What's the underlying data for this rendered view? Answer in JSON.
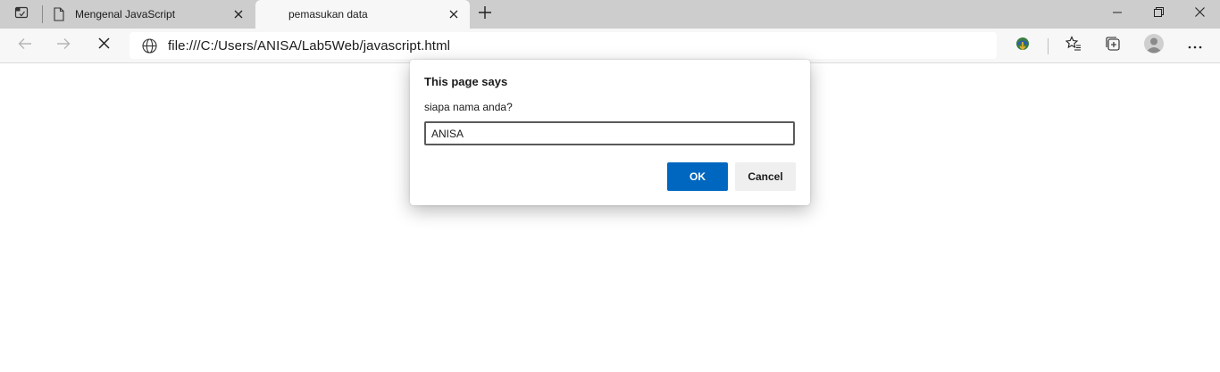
{
  "tabs": [
    {
      "title": "Mengenal JavaScript",
      "active": false,
      "icon": "document-icon"
    },
    {
      "title": "pemasukan data",
      "active": true,
      "icon": "none"
    }
  ],
  "address_bar": {
    "url": "file:///C:/Users/ANISA/Lab5Web/javascript.html",
    "site_icon": "globe-icon"
  },
  "dialog": {
    "title": "This page says",
    "message": "siapa nama anda?",
    "input_value": "ANISA",
    "ok_label": "OK",
    "cancel_label": "Cancel"
  },
  "colors": {
    "accent": "#0067c0",
    "tabstrip": "#cdcdcd",
    "toolbar": "#f7f7f7"
  }
}
